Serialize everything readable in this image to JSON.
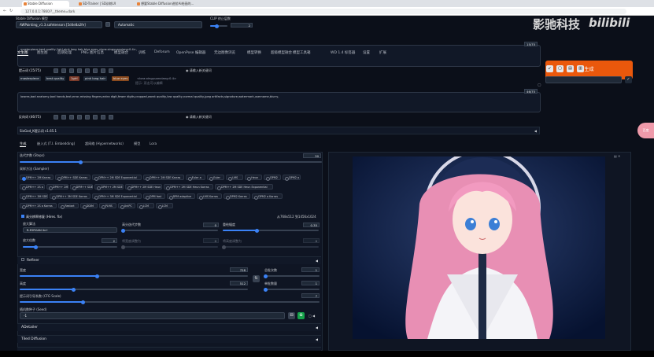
{
  "browser": {
    "tabs": [
      "Stable Diffusion",
      "SD-Trainer | SD训练UI",
      "想要Stable Diffusion进阶Ai绘画的..."
    ],
    "url": "127.0.0.1:7860/?__theme=dark"
  },
  "top": {
    "model_label": "Stable Diffusion 模型",
    "model_value": "AWPainting_v1.3.safetensors [5d4e8a2fe]",
    "vae_value": "Automatic",
    "clip_label": "CLIP 终止层数",
    "clip_value": "2"
  },
  "tabs": [
    "文生图",
    "图生图",
    "后期处理",
    "PNG 图片信息",
    "模型融合",
    "训练",
    "Deforum",
    "OpenPose 编辑器",
    "无边图像浏览",
    "模型转换",
    "超级模型融合",
    "模型工具箱",
    "WD 1.4 标签器",
    "设置",
    "扩展"
  ],
  "prompt": {
    "text": "masterpiece,best quality,1girl,pink long hair,blue eyes,<lora:xingyuanxiang:0.4>,",
    "counter": "15/75",
    "section_label": "提示词",
    "section_count": "(15/75)",
    "toggle_label": "请输入新关键词",
    "tokens": [
      "masterpiece",
      "best quality",
      "1girl",
      "pink long hair",
      "blue eyes",
      "<lora:xingyuanxiang:0.4>"
    ],
    "token_hint": "提示: 双击可以编辑"
  },
  "negative": {
    "text": "lowres,bad anatomy,bad hands,text,error,missing fingers,extra digit,fewer digits,cropped,worst quality,low quality,normal quality,jpeg artifacts,signature,watermark,username,blurry,",
    "counter": "46/75",
    "section_label": "反向词",
    "section_count": "(46/75)",
    "toggle_label": "请输入新关键词"
  },
  "generate": {
    "label": "生成"
  },
  "sixgod": {
    "label": "SixGod_K提示词 v1.65.1"
  },
  "subtabs": [
    "生成",
    "嵌入式 (T.I. Embedding)",
    "超网络 (Hypernetworks)",
    "模型",
    "Lora"
  ],
  "sampling": {
    "steps_label": "迭代步数 (Steps)",
    "steps_value": "30",
    "steps_fraction": 0.2,
    "method_label": "采样方法 (Sampler)",
    "methods": [
      [
        "DPM++ 2M Karras",
        "DPM++ SDE Karras",
        "DPM++ 2M SDE Exponential",
        "DPM++ 2M SDE Karras",
        "Euler a",
        "Euler",
        "LMS",
        "Heun",
        "DPM2",
        "DPM2 a"
      ],
      [
        "DPM++ 2S a",
        "DPM++ 2M",
        "DPM++ SDE",
        "DPM++ 2M SDE",
        "DPM++ 2M SDE Heun",
        "DPM++ 2M SDE Heun Karras",
        "DPM++ 2M SDE Heun Exponential"
      ],
      [
        "DPM++ 3M SDE",
        "DPM++ 3M SDE Karras",
        "DPM++ 3M SDE Exponential",
        "DPM fast",
        "DPM adaptive",
        "LMS Karras",
        "DPM2 Karras",
        "DPM2 a Karras"
      ],
      [
        "DPM++ 2S a Karras",
        "Restart",
        "DDIM",
        "PLMS",
        "UniPC",
        "LCM",
        "LCM"
      ]
    ]
  },
  "hires": {
    "label": "高分辨率修复 (Hires. fix)",
    "size_note": "从768x512 到1456x1024",
    "upscaler_label": "放大算法",
    "upscaler_value": "R-ESRGAN 4x+",
    "steps_label": "高分迭代步数",
    "steps_value": "0",
    "denoise_label": "重绘幅度",
    "denoise_value": "0.35",
    "scale_label": "放大倍数",
    "scale_value": "2",
    "resize_w_label": "将宽度调整为",
    "resize_w_value": "0",
    "resize_h_label": "将高度调整为",
    "resize_h_value": "0"
  },
  "refiner": {
    "label": "Refiner"
  },
  "size": {
    "width_label": "宽度",
    "width_value": "728",
    "height_label": "高度",
    "height_value": "512",
    "batch_count_label": "总批次数",
    "batch_count_value": "1",
    "batch_size_label": "单批数量",
    "batch_size_value": "1"
  },
  "cfg": {
    "label": "提示词引导系数 (CFG Scale)",
    "value": "7",
    "fraction": 0.2
  },
  "seed": {
    "label": "随机数种子 (Seed)",
    "value": "-1"
  },
  "accordions": [
    "ADetailer",
    "Tiled Diffusion",
    "Tiled VAE"
  ],
  "watermark": {
    "left": "影驰科技",
    "right": "bilibili"
  },
  "edge_badge": "百度"
}
